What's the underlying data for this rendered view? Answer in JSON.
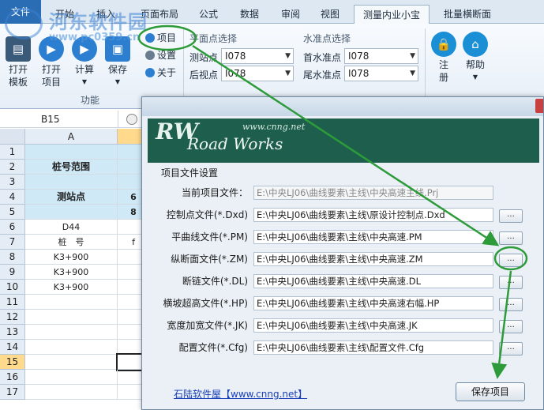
{
  "tabs": [
    "文件",
    "开始",
    "插入",
    "页面布局",
    "公式",
    "数据",
    "审阅",
    "视图",
    "测量内业小宝",
    "批量横断面"
  ],
  "ribbon": {
    "open_template": "打开\n模板",
    "open_project": "打开\n项目",
    "calculate": "计算",
    "save": "保存",
    "group_function": "功能",
    "project_item": "项目",
    "settings_item": "设置",
    "about_item": "关于",
    "plane_point_title": "平面点选择",
    "station_point_label": "测站点",
    "station_point_value": "I078",
    "back_point_label": "后视点",
    "back_point_value": "I078",
    "level_point_title": "水准点选择",
    "first_level_label": "首水准点",
    "first_level_value": "I078",
    "last_level_label": "尾水准点",
    "last_level_value": "I078",
    "register": "注\n册",
    "help": "帮助"
  },
  "formula_bar": {
    "cell_ref": "B15"
  },
  "sheet": {
    "col_a": "A",
    "rows": [
      "1",
      "2",
      "3",
      "4",
      "5",
      "6",
      "7",
      "8",
      "9",
      "10",
      "11",
      "12",
      "13",
      "14",
      "15",
      "16",
      "17"
    ],
    "selected_row": "15",
    "cells": {
      "r2": "桩号范围",
      "r4": "测站点",
      "r6": "D44",
      "r7": "桩　号",
      "r8": "K3+900",
      "r9": "K3+900",
      "r10": "K3+900",
      "b4": "6",
      "b5": "8",
      "b7": "f"
    }
  },
  "dialog": {
    "brand": "Road Works",
    "logo": "RW",
    "url": "www.cnng.net",
    "section_title": "项目文件设置",
    "fields": [
      {
        "label": "当前项目文件：",
        "value": "E:\\中央LJ06\\曲线要素\\主线\\中央高速主线.Prj"
      },
      {
        "label": "控制点文件(*.Dxd)",
        "value": "E:\\中央LJ06\\曲线要素\\主线\\原设计控制点.Dxd"
      },
      {
        "label": "平曲线文件(*.PM)",
        "value": "E:\\中央LJ06\\曲线要素\\主线\\中央高速.PM"
      },
      {
        "label": "纵断面文件(*.ZM)",
        "value": "E:\\中央LJ06\\曲线要素\\主线\\中央高速.ZM"
      },
      {
        "label": "断链文件(*.DL)",
        "value": "E:\\中央LJ06\\曲线要素\\主线\\中央高速.DL"
      },
      {
        "label": "横坡超高文件(*.HP)",
        "value": "E:\\中央LJ06\\曲线要素\\主线\\中央高速右幅.HP"
      },
      {
        "label": "宽度加宽文件(*.JK)",
        "value": "E:\\中央LJ06\\曲线要素\\主线\\中央高速.JK"
      },
      {
        "label": "配置文件(*.Cfg)",
        "value": "E:\\中央LJ06\\曲线要素\\主线\\配置文件.Cfg"
      }
    ],
    "browse_label": "...",
    "footer_link": "石陆软件屋【www.cnng.net】",
    "save_button": "保存项目"
  },
  "watermark": {
    "name": "河东软件园",
    "url": "www.pc0359.cn"
  },
  "colors": {
    "annotation": "#2d9b3a",
    "banner": "#1d5f4c",
    "file_tab": "#2a6db5"
  }
}
